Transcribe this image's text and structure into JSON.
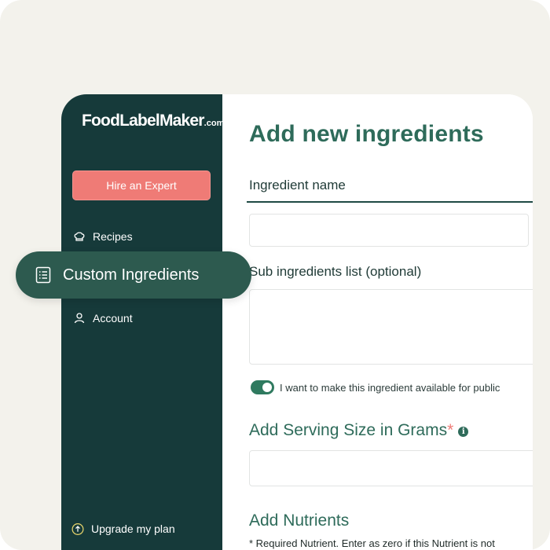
{
  "app": {
    "logo_main": "FoodLabelMaker",
    "logo_suffix": ".com"
  },
  "sidebar": {
    "hire_button": "Hire an Expert",
    "items": [
      {
        "label": "Recipes",
        "icon": "chef-hat-icon"
      },
      {
        "label": "Custom Ingredients",
        "icon": "list-icon",
        "active": true
      },
      {
        "label": "Account",
        "icon": "user-icon"
      }
    ],
    "upgrade_label": "Upgrade my plan",
    "upgrade_icon": "arrow-up-circle-icon"
  },
  "main": {
    "title": "Add new ingredients",
    "tab_label": "Ingredient name",
    "ingredient_name_value": "",
    "sub_ingredients_label": "Sub ingredients list (optional)",
    "sub_ingredients_value": "",
    "public_toggle_label": "I want to make this ingredient available for public",
    "public_toggle_on": true,
    "serving_label": "Add Serving Size in Grams",
    "serving_required_mark": "*",
    "serving_info_icon": "info-icon",
    "serving_value": "",
    "nutrients_label": "Add Nutrients",
    "nutrients_note": "* Required Nutrient. Enter as zero if this Nutrient is not"
  },
  "colors": {
    "sidebar_bg": "#163a3a",
    "accent_green": "#2e6b5a",
    "hire_button": "#ef7b76",
    "highlight_pill": "#2d5a4f",
    "outer_bg": "#f3f2ec"
  }
}
